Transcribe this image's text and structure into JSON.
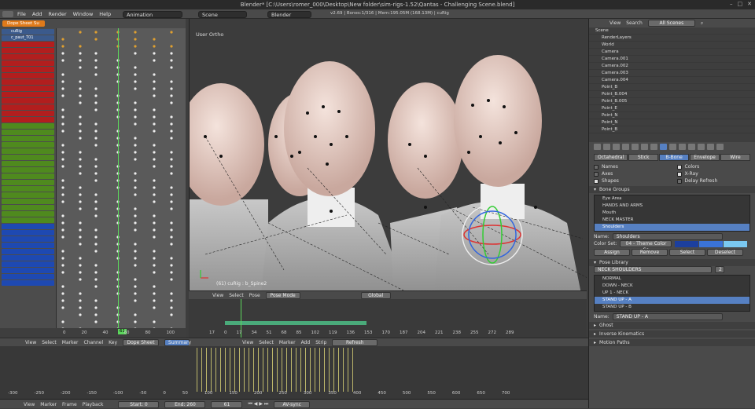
{
  "window": {
    "title": "Blender* [C:\\Users\\romer_000\\Desktop\\New folder\\sim-rigs-1.52\\Qantas - Challenging Scene.blend]"
  },
  "menubar": {
    "items": [
      "File",
      "Add",
      "Render",
      "Window",
      "Help"
    ],
    "screen": "Animation",
    "scene": "Scene",
    "engine": "Blender Render",
    "stats": "v2.69 | Bones:1/316 | Mem:195.05M (168.13M) | cuRig"
  },
  "dopesheet": {
    "mode": "Dope Sheet Su",
    "header": [
      "cuRig",
      "c_paut_T01"
    ],
    "lower": [
      "cuRig.003",
      "c_paut_T01"
    ],
    "current_frame": "61",
    "ticks": [
      "0",
      "20",
      "40",
      "60",
      "80",
      "100"
    ]
  },
  "viewport": {
    "label": "User Ortho",
    "object_label": "(61) cuRig : b_Spine2",
    "mode": "Pose Mode",
    "orientation": "Global",
    "menu": [
      "View",
      "Select",
      "Pose"
    ]
  },
  "timeline": {
    "menu": [
      "View",
      "Select",
      "Marker",
      "Channel",
      "Key"
    ],
    "mode": "Dope Sheet",
    "summary": "Summary",
    "ticks": [
      "17",
      "0",
      "17",
      "34",
      "51",
      "68",
      "85",
      "102",
      "119",
      "136",
      "153",
      "170",
      "187",
      "204",
      "221",
      "238",
      "255",
      "272",
      "289"
    ],
    "frame": "61"
  },
  "sequencer": {
    "menu": [
      "View",
      "Select",
      "Marker",
      "Add",
      "Strip"
    ],
    "refresh": "Refresh Sequencer",
    "ticks": [
      "-300",
      "-250",
      "-200",
      "-150",
      "-100",
      "-50",
      "0",
      "50",
      "100",
      "150",
      "200",
      "250",
      "300",
      "350",
      "400",
      "450",
      "500",
      "550",
      "600",
      "650",
      "700"
    ]
  },
  "footer": {
    "menu": [
      "View",
      "Marker",
      "Frame",
      "Playback"
    ],
    "start": "Start: 0",
    "end": "End: 260",
    "frame": "61",
    "sync": "AV-sync"
  },
  "outliner": {
    "menu": [
      "View",
      "Search"
    ],
    "display": "All Scenes",
    "items": [
      "Scene",
      "RenderLayers",
      "World",
      "Camera",
      "Camera.001",
      "Camera.002",
      "Camera.003",
      "Camera.004",
      "Point_B",
      "Point_B.004",
      "Point_B.005",
      "Point_E",
      "Point_N",
      "Point_N",
      "Point_B"
    ]
  },
  "armature": {
    "tabs": [
      "Octahedral",
      "Stick",
      "B-Bone",
      "Envelope",
      "Wire"
    ],
    "active_tab": "B-Bone",
    "options": [
      {
        "label": "Names",
        "on": false
      },
      {
        "label": "Colors",
        "on": true
      },
      {
        "label": "Axes",
        "on": false
      },
      {
        "label": "X-Ray",
        "on": true
      },
      {
        "label": "Shapes",
        "on": true
      },
      {
        "label": "Delay Refresh",
        "on": false
      }
    ]
  },
  "bone_groups": {
    "title": "Bone Groups",
    "items": [
      "Eye Area",
      "HANDS AND ARMS",
      "Mouth",
      "NECK MASTER",
      "Shoulders"
    ],
    "selected": "Shoulders",
    "name_label": "Name:",
    "name_value": "Shoulders",
    "color_set_label": "Color Set:",
    "color_set": "04 - Theme Color Se",
    "buttons": [
      "Assign",
      "Remove",
      "Select",
      "Deselect"
    ],
    "colors": [
      "#1c3f9e",
      "#3a73d8",
      "#7ac8f0"
    ]
  },
  "pose_library": {
    "title": "Pose Library",
    "library": "NECK SHOULDERS",
    "library_count": "2",
    "items": [
      "NORMAL",
      "DOWN - NECK",
      "UP 1 - NECK",
      "STAND UP - A",
      "STAND UP - B"
    ],
    "selected": "STAND UP - A",
    "name_label": "Name:",
    "name_value": "STAND UP - A"
  },
  "panels": [
    "Ghost",
    "Inverse Kinematics",
    "Motion Paths"
  ]
}
